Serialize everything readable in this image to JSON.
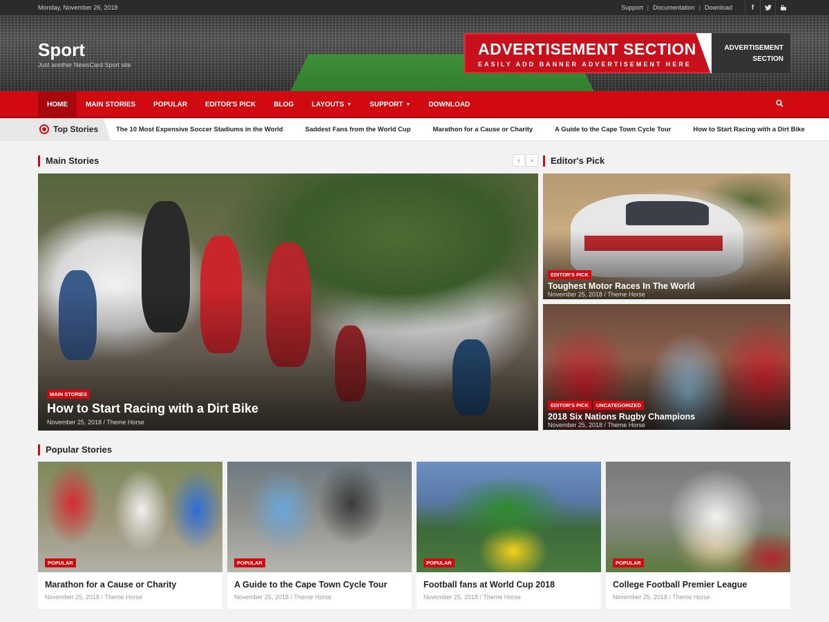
{
  "topbar": {
    "date": "Monday, November 26, 2018",
    "links": [
      "Support",
      "Documentation",
      "Download"
    ],
    "social_icons": [
      "facebook-icon",
      "twitter-icon",
      "youtube-icon"
    ]
  },
  "header": {
    "site_title": "Sport",
    "tagline": "Just another NewsCard Sport site",
    "ad_title": "ADVERTISEMENT SECTION",
    "ad_subtitle": "EASILY ADD BANNER ADVERTISEMENT HERE",
    "ad_side_line1": "ADVERTISEMENT",
    "ad_side_line2": "SECTION"
  },
  "nav": {
    "items": [
      {
        "label": "HOME",
        "active": true
      },
      {
        "label": "MAIN STORIES"
      },
      {
        "label": "POPULAR"
      },
      {
        "label": "EDITOR'S PICK"
      },
      {
        "label": "BLOG"
      },
      {
        "label": "LAYOUTS",
        "dropdown": true
      },
      {
        "label": "SUPPORT",
        "dropdown": true
      },
      {
        "label": "DOWNLOAD"
      }
    ],
    "search_icon": "search-icon"
  },
  "ticker": {
    "title": "Top Stories",
    "items": [
      "The 10 Most Expensive Soccer Stadiums in the World",
      "Saddest Fans from the World Cup",
      "Marathon for a Cause or Charity",
      "A Guide to the Cape Town Cycle Tour",
      "How to Start Racing with a Dirt Bike"
    ]
  },
  "main_stories": {
    "heading": "Main Stories",
    "prev": "‹",
    "next": "›",
    "featured": {
      "badge": "MAIN STORIES",
      "title": "How to Start Racing with a Dirt Bike",
      "meta": "November 25, 2018 / Theme Horse"
    }
  },
  "editors_pick": {
    "heading": "Editor's Pick",
    "posts": [
      {
        "badges": [
          "EDITOR'S PICK"
        ],
        "title": "Toughest Motor Races In The World",
        "meta": "November 25, 2018 / Theme Horse"
      },
      {
        "badges": [
          "EDITOR'S PICK",
          "UNCATEGORIZED"
        ],
        "title": "2018 Six Nations Rugby Champions",
        "meta": "November 25, 2018 / Theme Horse"
      }
    ]
  },
  "popular": {
    "heading": "Popular Stories",
    "cards": [
      {
        "badge": "POPULAR",
        "title": "Marathon for a Cause or Charity",
        "meta": "November 25, 2018 / Theme Horse"
      },
      {
        "badge": "POPULAR",
        "title": "A Guide to the Cape Town Cycle Tour",
        "meta": "November 25, 2018 / Theme Horse"
      },
      {
        "badge": "POPULAR",
        "title": "Football fans at World Cup 2018",
        "meta": "November 25, 2018 / Theme Horse"
      },
      {
        "badge": "POPULAR",
        "title": "College Football Premier League",
        "meta": "November 25, 2018 / Theme Horse"
      }
    ]
  },
  "colors": {
    "accent": "#d10a11",
    "topbar": "#2b2b2b"
  }
}
